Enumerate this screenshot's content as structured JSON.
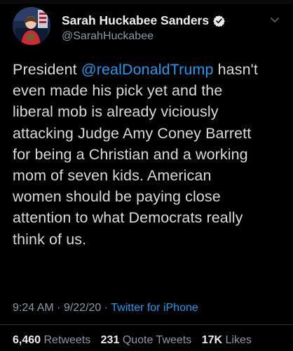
{
  "colors": {
    "background": "#000000",
    "text": "#d9d9d9",
    "secondary": "#8b98a5",
    "accent": "#1d9bf0",
    "divider": "#2f3336"
  },
  "author": {
    "display_name": "Sarah Huckabee Sanders",
    "handle": "@SarahHuckabee",
    "verified_icon": "verified-badge-icon",
    "avatar_icon": "profile-photo"
  },
  "menu_icon": "chevron-down-icon",
  "tweet": {
    "lines": [
      {
        "pre": "President ",
        "mention": "@realDonaldTrump",
        "post": " hasn't"
      },
      {
        "text": "even made his pick yet and the"
      },
      {
        "text": "liberal mob is already viciously"
      },
      {
        "text": "attacking Judge Amy Coney Barrett"
      },
      {
        "text": "for being a Christian and a working"
      },
      {
        "text": "mom of seven kids. American"
      },
      {
        "text": "women should be paying close"
      },
      {
        "text": "attention to what Democrats really"
      },
      {
        "text": "think of us."
      }
    ]
  },
  "meta": {
    "time": "9:24 AM",
    "separator": "·",
    "date": "9/22/20",
    "source": "Twitter for iPhone"
  },
  "stats": {
    "retweets_count": "6,460",
    "retweets_label": "Retweets",
    "quotes_count": "231",
    "quotes_label": "Quote Tweets",
    "likes_count": "17K",
    "likes_label": "Likes"
  }
}
